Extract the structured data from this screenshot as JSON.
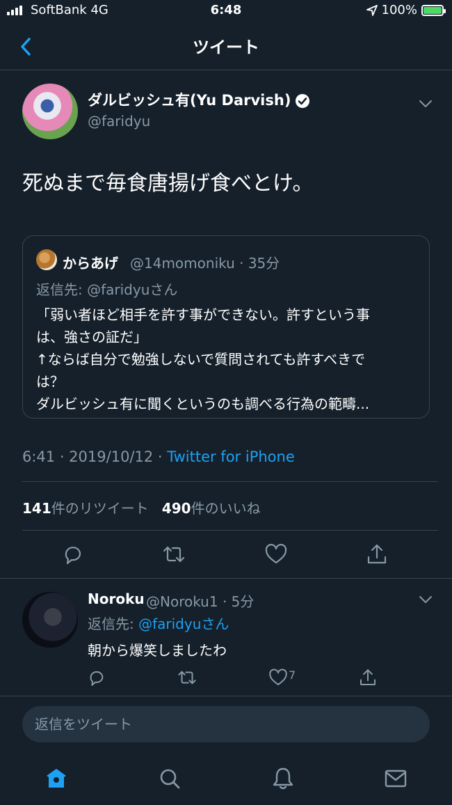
{
  "status_bar": {
    "carrier": "SoftBank 4G",
    "time": "6:48",
    "battery": "100%"
  },
  "header": {
    "title": "ツイート"
  },
  "tweet": {
    "author_name": "ダルビッシュ有(Yu Darvish)",
    "handle": "@faridyu",
    "text": "死ぬまで毎食唐揚げ食べとけ。",
    "quote": {
      "author_name": "からあげ",
      "handle_time": "@14momoniku · 35分",
      "reply_to": "返信先: @faridyuさん",
      "lines": [
        "「弱い者ほど相手を許す事ができない。許すという事",
        "は、強さの証だ」",
        "↑ならば自分で勉強しないで質問されても許すべきで",
        "は？",
        "ダルビッシュ有に聞くというのも調べる行為の範疇..."
      ]
    },
    "timestamp": "6:41 · 2019/10/12 · ",
    "source": "Twitter for iPhone",
    "retweet_count": "141",
    "retweet_label": "件のリツイート",
    "like_count": "490",
    "like_label": "件のいいね"
  },
  "reply": {
    "author_name": "Noroku",
    "handle_time": "@Noroku1 · 5分",
    "reply_to_prefix": "返信先: ",
    "reply_to_user": "@faridyuさん",
    "text": "朝から爆笑しましたわ",
    "like_count": "7"
  },
  "composer": {
    "placeholder": "返信をツイート"
  },
  "tabs": [
    "home-icon",
    "search-icon",
    "notifications-icon",
    "messages-icon"
  ],
  "colors": {
    "background": "#15202b",
    "accent": "#1da1f2",
    "muted": "#8899a6",
    "divider": "#38444d"
  }
}
